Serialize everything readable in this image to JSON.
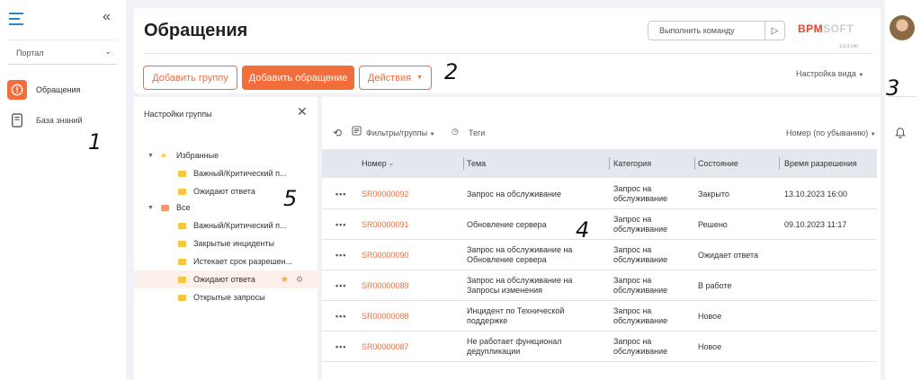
{
  "sidebar": {
    "portal_select": "Портал",
    "items": [
      {
        "label": "Обращения"
      },
      {
        "label": "База знаний"
      }
    ]
  },
  "header": {
    "title": "Обращения",
    "command_placeholder": "Выполнить команду",
    "logo_part1": "BPM",
    "logo_part2": "SOFT",
    "version": "1.0.3.140",
    "buttons": {
      "add_group": "Добавить группу",
      "add_case": "Добавить обращение",
      "actions": "Действия"
    },
    "view_settings": "Настройка вида"
  },
  "group_panel": {
    "title": "Настройки группы",
    "tree": [
      {
        "label": "Избранные",
        "level": 0,
        "kind": "star"
      },
      {
        "label": "Важный/Критический п...",
        "level": 1,
        "kind": "folder"
      },
      {
        "label": "Ожидают ответа",
        "level": 1,
        "kind": "folder"
      },
      {
        "label": "Все",
        "level": 0,
        "kind": "folder-root"
      },
      {
        "label": "Важный/Критический п...",
        "level": 1,
        "kind": "folder"
      },
      {
        "label": "Закрытые инциденты",
        "level": 1,
        "kind": "folder"
      },
      {
        "label": "Истекает срок разрешен...",
        "level": 1,
        "kind": "folder"
      },
      {
        "label": "Ожидают ответа",
        "level": 1,
        "kind": "folder",
        "active": true
      },
      {
        "label": "Открытые запросы",
        "level": 1,
        "kind": "folder"
      }
    ]
  },
  "toolbar": {
    "filters": "Фильтры/группы",
    "tags": "Теги",
    "sort": "Номер (по убыванию)"
  },
  "grid": {
    "columns": [
      "Номер",
      "Тема",
      "Категория",
      "Состояние",
      "Время разрешения"
    ],
    "rows": [
      {
        "number": "SR00000092",
        "topic": "Запрос на обслуживание",
        "category": "Запрос на обслуживание",
        "state": "Закрыто",
        "resolved": "13.10.2023 16:00"
      },
      {
        "number": "SR00000091",
        "topic": "Обновление сервера",
        "category": "Запрос на обслуживание",
        "state": "Решено",
        "resolved": "09.10.2023 11:17"
      },
      {
        "number": "SR00000090",
        "topic": "Запрос на обслуживание на Обновление сервера",
        "category": "Запрос на обслуживание",
        "state": "Ожидает ответа",
        "resolved": ""
      },
      {
        "number": "SR00000089",
        "topic": "Запрос на обслуживание на Запросы изменения",
        "category": "Запрос на обслуживание",
        "state": "В работе",
        "resolved": ""
      },
      {
        "number": "SR00000088",
        "topic": "Инцидент по Технической поддержке",
        "category": "Запрос на обслуживание",
        "state": "Новое",
        "resolved": ""
      },
      {
        "number": "SR00000087",
        "topic": "Не работает функционал дедупликации",
        "category": "Запрос на обслуживание",
        "state": "Новое",
        "resolved": ""
      }
    ]
  },
  "annotations": [
    "1",
    "2",
    "3",
    "4",
    "5"
  ],
  "colors": {
    "accent": "#f26d3a",
    "folder": "#f7c744",
    "grid_header": "#e4e8ee"
  }
}
